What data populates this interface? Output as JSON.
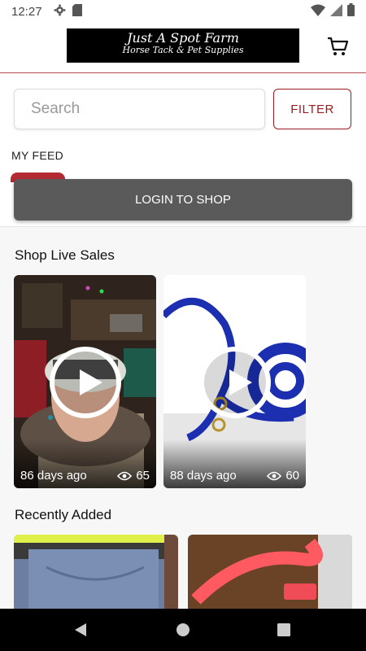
{
  "status": {
    "time": "12:27"
  },
  "header": {
    "logo_line1": "Just A Spot Farm",
    "logo_line2": "Horse Tack & Pet Supplies"
  },
  "search": {
    "placeholder": "Search",
    "filter_label": "FILTER"
  },
  "feed": {
    "label": "MY FEED",
    "login_label": "LOGIN TO SHOP"
  },
  "live": {
    "title": "Shop Live Sales",
    "cards": [
      {
        "days": "86 days ago",
        "views": "65"
      },
      {
        "days": "88 days ago",
        "views": "60"
      }
    ]
  },
  "recent": {
    "title": "Recently Added"
  },
  "colors": {
    "brand": "#9c1b22",
    "login_bg": "#5a5a5a"
  }
}
